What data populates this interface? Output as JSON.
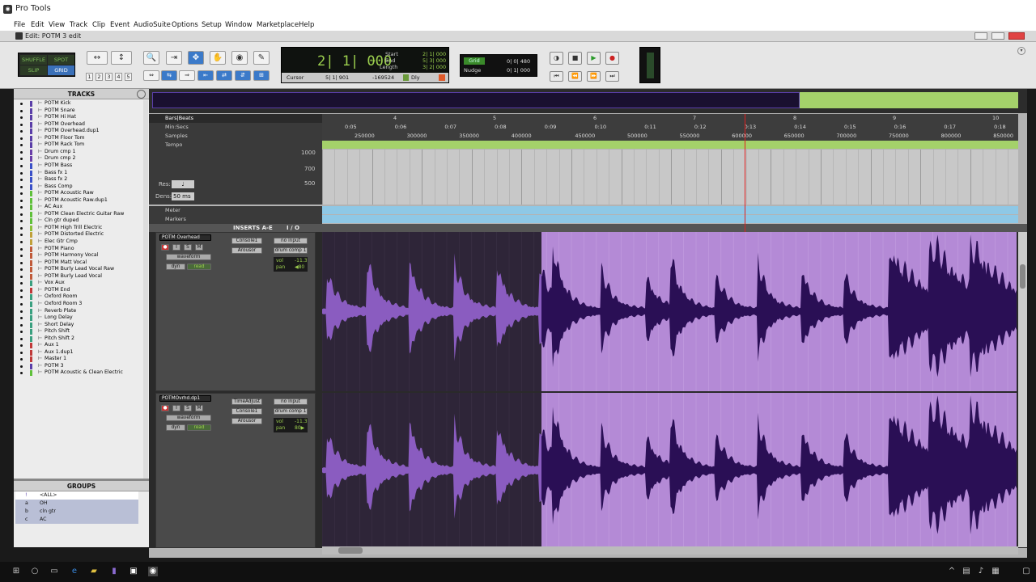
{
  "window": {
    "app_title": "Pro Tools",
    "doc_title": "Edit: POTM 3 edit"
  },
  "menu": [
    "File",
    "Edit",
    "View",
    "Track",
    "Clip",
    "Event",
    "AudioSuite",
    "Options",
    "Setup",
    "Window",
    "Marketplace",
    "Help"
  ],
  "modes": {
    "shuffle": "SHUFFLE",
    "spot": "SPOT",
    "slip": "SLIP",
    "grid": "GRID"
  },
  "zoom_presets": [
    "1",
    "2",
    "3",
    "4",
    "5"
  ],
  "counter": {
    "main": "2| 1| 000",
    "start_label": "Start",
    "end_label": "End",
    "length_label": "Length",
    "start": "2| 1| 000",
    "end": "5| 3| 000",
    "length": "3| 2| 000",
    "cursor_label": "Cursor",
    "cursor": "5| 1| 901",
    "cursor_val": "-169524",
    "dly": "Dly"
  },
  "grid": {
    "grid_label": "Grid",
    "grid_value": "0| 0| 480",
    "nudge_label": "Nudge",
    "nudge_value": "0| 1| 000"
  },
  "panels": {
    "tracks": "TRACKS",
    "groups": "GROUPS"
  },
  "tracks": [
    {
      "name": "POTM Kick",
      "color": "#5a3ea8"
    },
    {
      "name": "POTM Snare",
      "color": "#5a3ea8"
    },
    {
      "name": "POTM Hi Hat",
      "color": "#5a3ea8"
    },
    {
      "name": "POTM Overhead",
      "color": "#5a3ea8"
    },
    {
      "name": "POTM Overhead.dup1",
      "color": "#5a3ea8"
    },
    {
      "name": "POTM Floor Tom",
      "color": "#5a3ea8"
    },
    {
      "name": "POTM Rack Tom",
      "color": "#5a3ea8"
    },
    {
      "name": "Drum cmp 1",
      "color": "#6a3ea8"
    },
    {
      "name": "Drum cmp 2",
      "color": "#6a3ea8"
    },
    {
      "name": "POTM Bass",
      "color": "#3a50c8"
    },
    {
      "name": "Bass fx 1",
      "color": "#3a50c8"
    },
    {
      "name": "Bass fx 2",
      "color": "#3a50c8"
    },
    {
      "name": "Bass Comp",
      "color": "#3a50c8"
    },
    {
      "name": "POTM Acoustic Raw",
      "color": "#5fc03a"
    },
    {
      "name": "POTM Acoustic Raw.dup1",
      "color": "#5fc03a"
    },
    {
      "name": "AC Aux",
      "color": "#5fc03a"
    },
    {
      "name": "POTM Clean Electric Guitar Raw",
      "color": "#5fc03a"
    },
    {
      "name": "Cln gtr duped",
      "color": "#5fc03a"
    },
    {
      "name": "POTM High Trill Electric",
      "color": "#8ac03a"
    },
    {
      "name": "POTM Distorted Electric",
      "color": "#c0a03a"
    },
    {
      "name": "Elec Gtr Cmp",
      "color": "#c0a03a"
    },
    {
      "name": "POTM Piano",
      "color": "#c05a3a"
    },
    {
      "name": "POTM Harmony Vocal",
      "color": "#c05a3a"
    },
    {
      "name": "POTM Matt Vocal",
      "color": "#c05a3a"
    },
    {
      "name": "POTM Burly Lead Vocal Raw",
      "color": "#c05a3a"
    },
    {
      "name": "POTM Burly Lead Vocal",
      "color": "#c05a3a"
    },
    {
      "name": "Vox Aux",
      "color": "#3aa080"
    },
    {
      "name": "POTM End",
      "color": "#c03a3a"
    },
    {
      "name": "Oxford Room",
      "color": "#3aa080"
    },
    {
      "name": "Oxford Room 3",
      "color": "#3aa080"
    },
    {
      "name": "Reverb Plate",
      "color": "#3aa080"
    },
    {
      "name": "Long Delay",
      "color": "#3aa080"
    },
    {
      "name": "Short Delay",
      "color": "#3aa080"
    },
    {
      "name": "Pitch Shift",
      "color": "#3aa080"
    },
    {
      "name": "Pitch Shift 2",
      "color": "#3aa080"
    },
    {
      "name": "Aux 1",
      "color": "#c03a3a"
    },
    {
      "name": "Aux 1.dup1",
      "color": "#c03a3a"
    },
    {
      "name": "Master 1",
      "color": "#c03a3a"
    },
    {
      "name": "POTM 3",
      "color": "#5a3ea8"
    },
    {
      "name": "POTM Acoustic & Clean Electric",
      "color": "#5fc03a"
    }
  ],
  "groups": [
    {
      "id": "!",
      "name": "<ALL>"
    },
    {
      "id": "a",
      "name": "OH"
    },
    {
      "id": "b",
      "name": "cln gtr"
    },
    {
      "id": "c",
      "name": "AC"
    }
  ],
  "rulers": {
    "bars_beats": "Bars|Beats",
    "min_secs": "Min:Secs",
    "samples": "Samples",
    "tempo": "Tempo",
    "meter": "Meter",
    "markers": "Markers",
    "res": "Res:",
    "dens": "Dens:",
    "dens_val": "50 ms",
    "tempo_ticks": [
      "1000",
      "700",
      "500"
    ],
    "bars": [
      "4",
      "5",
      "6",
      "7",
      "8",
      "9",
      "10"
    ],
    "secs": [
      "0:05",
      "0:06",
      "0:07",
      "0:08",
      "0:09",
      "0:10",
      "0:11",
      "0:12",
      "0:13",
      "0:14",
      "0:15",
      "0:16",
      "0:17",
      "0:18"
    ],
    "samps": [
      "250000",
      "300000",
      "350000",
      "400000",
      "450000",
      "500000",
      "550000",
      "600000",
      "650000",
      "700000",
      "750000",
      "800000",
      "850000"
    ]
  },
  "columns": {
    "inserts": "INSERTS A-E",
    "io": "I / O"
  },
  "edit_tracks": [
    {
      "name": "POTM Overhead",
      "view": "waveform",
      "dyn": "dyn",
      "auto": "read",
      "inserts": [
        "Console1",
        "Arousor"
      ],
      "input": "no input",
      "output": "drum comp 1",
      "vol_label": "vol",
      "vol": "-11.3",
      "pan_label": "pan",
      "pan": "◀80"
    },
    {
      "name": "POTMOvrhd.dp1",
      "view": "waveform",
      "dyn": "dyn",
      "auto": "read",
      "inserts": [
        "TimeAdjust",
        "Console1",
        "Arousor"
      ],
      "input": "no input",
      "output": "drum comp 1",
      "vol_label": "vol",
      "vol": "-11.3",
      "pan_label": "pan",
      "pan": "80▶"
    }
  ],
  "colors": {
    "clip_dark": "#2e2538",
    "clip_light": "#b48ad6",
    "wave_dark": "#2a0f55",
    "wave_light": "#8a5cc0",
    "ruler_green": "#a4d16a",
    "meter_blue": "#8ec8e6",
    "playhead": "#e02020"
  }
}
